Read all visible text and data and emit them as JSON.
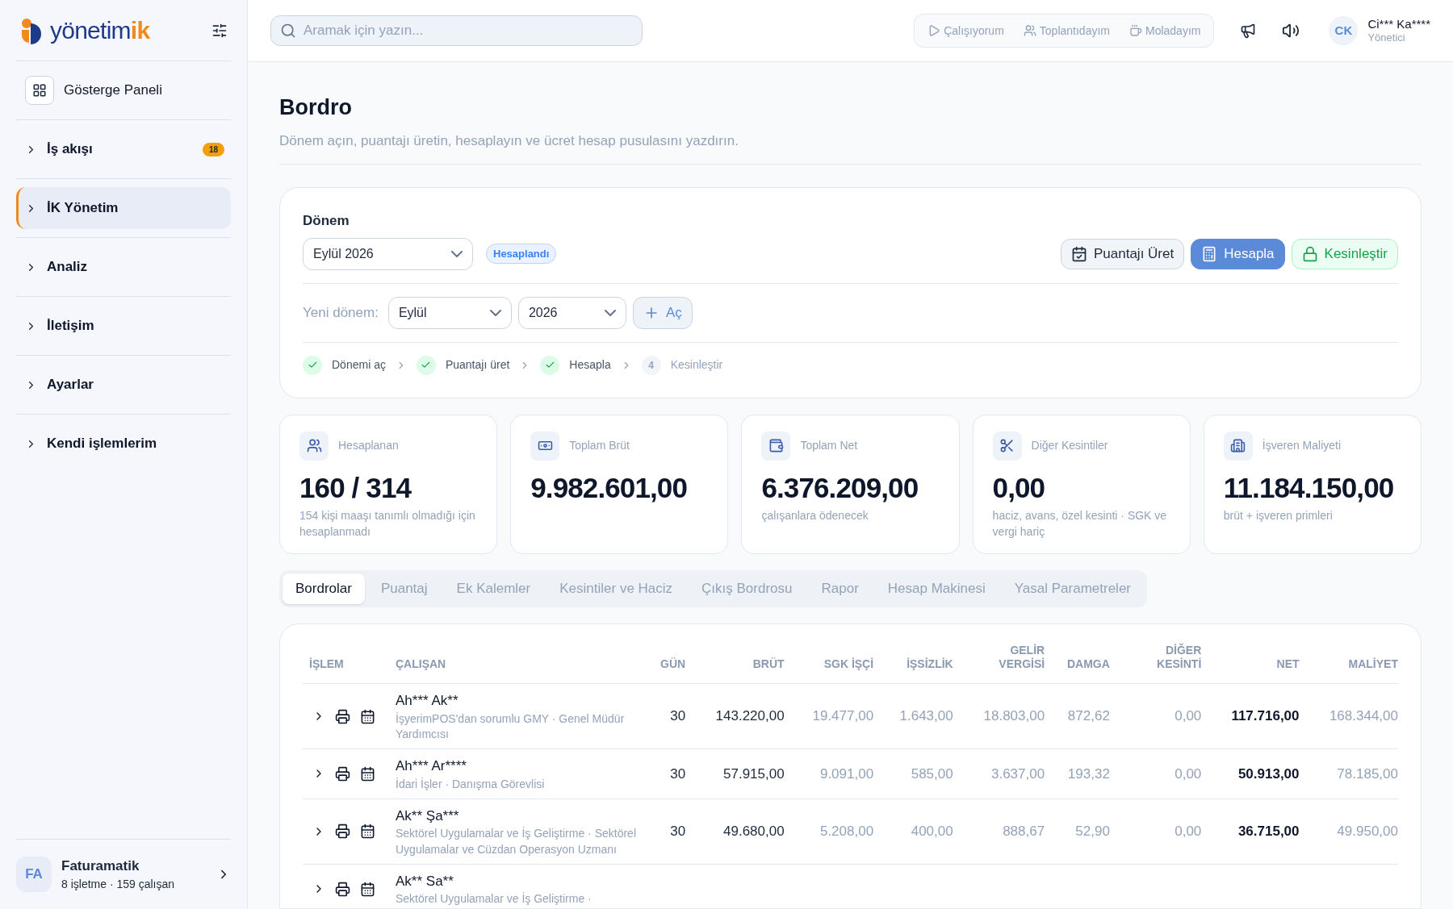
{
  "brand": {
    "name": "yönetim",
    "accent": "ik"
  },
  "sidebar": {
    "items": [
      {
        "label": "Gösterge Paneli",
        "kind": "dashboard",
        "selected": false
      },
      {
        "label": "İş akışı",
        "kind": "group",
        "badge": "18",
        "selected": false
      },
      {
        "label": "İK Yönetim",
        "kind": "group",
        "selected": true
      },
      {
        "label": "Analiz",
        "kind": "group",
        "selected": false
      },
      {
        "label": "İletişim",
        "kind": "group",
        "selected": false
      },
      {
        "label": "Ayarlar",
        "kind": "group",
        "selected": false
      },
      {
        "label": "Kendi işlemlerim",
        "kind": "group",
        "selected": false
      }
    ],
    "company": {
      "initials": "FA",
      "name": "Faturamatik",
      "detail": "8 işletme · 159 çalışan"
    }
  },
  "search": {
    "placeholder": "Aramak için yazın..."
  },
  "status_buttons": [
    {
      "label": "Çalışıyorum",
      "kind": "play"
    },
    {
      "label": "Toplantıdayım",
      "kind": "users"
    },
    {
      "label": "Moladayım",
      "kind": "coffee"
    }
  ],
  "user": {
    "initials": "CK",
    "name": "Ci*** Ka****",
    "role": "Yönetici"
  },
  "page": {
    "title": "Bordro",
    "subtitle": "Dönem açın, puantajı üretin, hesaplayın ve ücret hesap pusulasını yazdırın."
  },
  "period": {
    "label": "Dönem",
    "value": "Eylül 2026",
    "status": "Hesaplandı",
    "actions": [
      {
        "label": "Puantajı Üret",
        "kind": "outline"
      },
      {
        "label": "Hesapla",
        "kind": "primary"
      },
      {
        "label": "Kesinleştir",
        "kind": "success"
      }
    ],
    "new_label": "Yeni dönem:",
    "month": "Eylül",
    "year": "2026",
    "open_button": "Aç",
    "steps": [
      {
        "label": "Dönemi aç",
        "done": true
      },
      {
        "label": "Puantajı üret",
        "done": true
      },
      {
        "label": "Hesapla",
        "done": true
      },
      {
        "label": "Kesinleştir",
        "number": "4",
        "done": false
      }
    ]
  },
  "stats": [
    {
      "kind": "users",
      "label": "Hesaplanan",
      "value": "160 / 314",
      "note": "154 kişi maaşı tanımlı olmadığı için hesaplanmadı"
    },
    {
      "kind": "banknote",
      "label": "Toplam Brüt",
      "value": "9.982.601,00"
    },
    {
      "kind": "wallet",
      "label": "Toplam Net",
      "value": "6.376.209,00",
      "note": "çalışanlara ödenecek"
    },
    {
      "kind": "scissors",
      "label": "Diğer Kesintiler",
      "value": "0,00",
      "note": "haciz, avans, özel kesinti · SGK ve vergi hariç"
    },
    {
      "kind": "building",
      "label": "İşveren Maliyeti",
      "value": "11.184.150,00",
      "note": "brüt + işveren primleri"
    }
  ],
  "tabs": [
    {
      "label": "Bordrolar",
      "selected": true
    },
    {
      "label": "Puantaj",
      "selected": false
    },
    {
      "label": "Ek Kalemler",
      "selected": false
    },
    {
      "label": "Kesintiler ve Haciz",
      "selected": false
    },
    {
      "label": "Çıkış Bordrosu",
      "selected": false
    },
    {
      "label": "Rapor",
      "selected": false
    },
    {
      "label": "Hesap Makinesi",
      "selected": false
    },
    {
      "label": "Yasal Parametreler",
      "selected": false
    }
  ],
  "table": {
    "columns": [
      {
        "label": "İŞLEM",
        "kind": "action"
      },
      {
        "label": "ÇALIŞAN",
        "kind": "employee"
      },
      {
        "label": "GÜN",
        "kind": "dark"
      },
      {
        "label": "BRÜT",
        "kind": "dark"
      },
      {
        "label": "SGK İŞÇİ",
        "kind": "muted"
      },
      {
        "label": "İŞSİZLİK",
        "kind": "muted"
      },
      {
        "label": "GELİR VERGİSİ",
        "kind": "muted"
      },
      {
        "label": "DAMGA",
        "kind": "muted"
      },
      {
        "label": "DİĞER KESİNTİ",
        "kind": "muted"
      },
      {
        "label": "NET",
        "kind": "strong"
      },
      {
        "label": "MALİYET",
        "kind": "muted"
      }
    ],
    "rows": [
      {
        "name": "Ah*** Ak**",
        "detail": "İşyerimPOS'dan sorumlu GMY · Genel Müdür Yardımcısı",
        "values": [
          "30",
          "143.220,00",
          "19.477,00",
          "1.643,00",
          "18.803,00",
          "872,62",
          "0,00",
          "117.716,00",
          "168.344,00"
        ]
      },
      {
        "name": "Ah*** Ar****",
        "detail": "İdari İşler · Danışma Görevlisi",
        "values": [
          "30",
          "57.915,00",
          "9.091,00",
          "585,00",
          "3.637,00",
          "193,32",
          "0,00",
          "50.913,00",
          "78.185,00"
        ]
      },
      {
        "name": "Ak** Şa***",
        "detail": "Sektörel Uygulamalar ve İş Geliştirme · Sektörel Uygulamalar ve Cüzdan Operasyon Uzmanı",
        "values": [
          "30",
          "49.680,00",
          "5.208,00",
          "400,00",
          "888,67",
          "52,90",
          "0,00",
          "36.715,00",
          "49.950,00"
        ]
      },
      {
        "name": "Ak** Sa**",
        "detail": "Sektörel Uygulamalar ve İş Geliştirme ·"
      }
    ]
  }
}
